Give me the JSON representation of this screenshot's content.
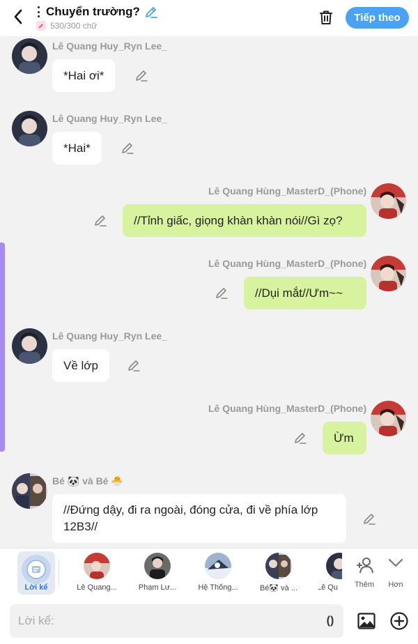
{
  "header": {
    "title": "Chuyển trường?",
    "char_count": "530/300 chữ",
    "next_label": "Tiếp theo"
  },
  "messages": [
    {
      "side": "left",
      "name": "Lê Quang Huy_Ryn Lee_",
      "text": "*Hai ơi*",
      "avatar": "huy"
    },
    {
      "side": "left",
      "name": "Lê Quang Huy_Ryn Lee_",
      "text": "*Hai*",
      "avatar": "huy"
    },
    {
      "side": "right",
      "name": "Lê Quang Hùng_MasterD_(Phone)",
      "text": "//Tỉnh giấc, giọng khàn khàn nói//Gì zọ?",
      "avatar": "hung"
    },
    {
      "side": "right",
      "name": "Lê Quang Hùng_MasterD_(Phone)",
      "text": "//Dụi mắt//Ưm~~",
      "avatar": "hung"
    },
    {
      "side": "left",
      "name": "Lê Quang Huy_Ryn Lee_",
      "text": "Về lớp",
      "avatar": "huy"
    },
    {
      "side": "right",
      "name": "Lê Quang Hùng_MasterD_(Phone)",
      "text": "Ừm",
      "avatar": "hung"
    },
    {
      "side": "left",
      "name": "Bé 🐼 và Bé 🐣",
      "text": "//Đứng dậy, đi ra ngoài, đóng cửa, đi về phía lớp 12B3//",
      "avatar": "be"
    }
  ],
  "characters": {
    "narrator_label": "Lời kể",
    "items": [
      {
        "label": "Lê Quang...",
        "avatar": "hung"
      },
      {
        "label": "Phạm Lư...",
        "avatar": "pham"
      },
      {
        "label": "Hệ Thống...",
        "avatar": "system"
      },
      {
        "label": "Bé🐼 và ...",
        "avatar": "be"
      },
      {
        "label": "Lê Qu",
        "avatar": "huy"
      }
    ],
    "add_label": "Thêm",
    "more_label": "Hơn"
  },
  "input": {
    "placeholder": "Lời kể:",
    "paren_label": "()"
  },
  "colors": {
    "accent": "#4aa2f4",
    "bubble_right": "#d8f39d",
    "bubble_left": "#ffffff",
    "scroll_indicator": "#a88bf0"
  },
  "icons": {
    "back": "chevron-left-icon",
    "title_edit": "pencil-icon",
    "trash": "trash-icon",
    "bubble_edit": "pencil-icon",
    "add_character": "add-person-icon",
    "more": "chevron-down-icon",
    "image": "image-icon",
    "plus": "plus-circle-icon"
  }
}
